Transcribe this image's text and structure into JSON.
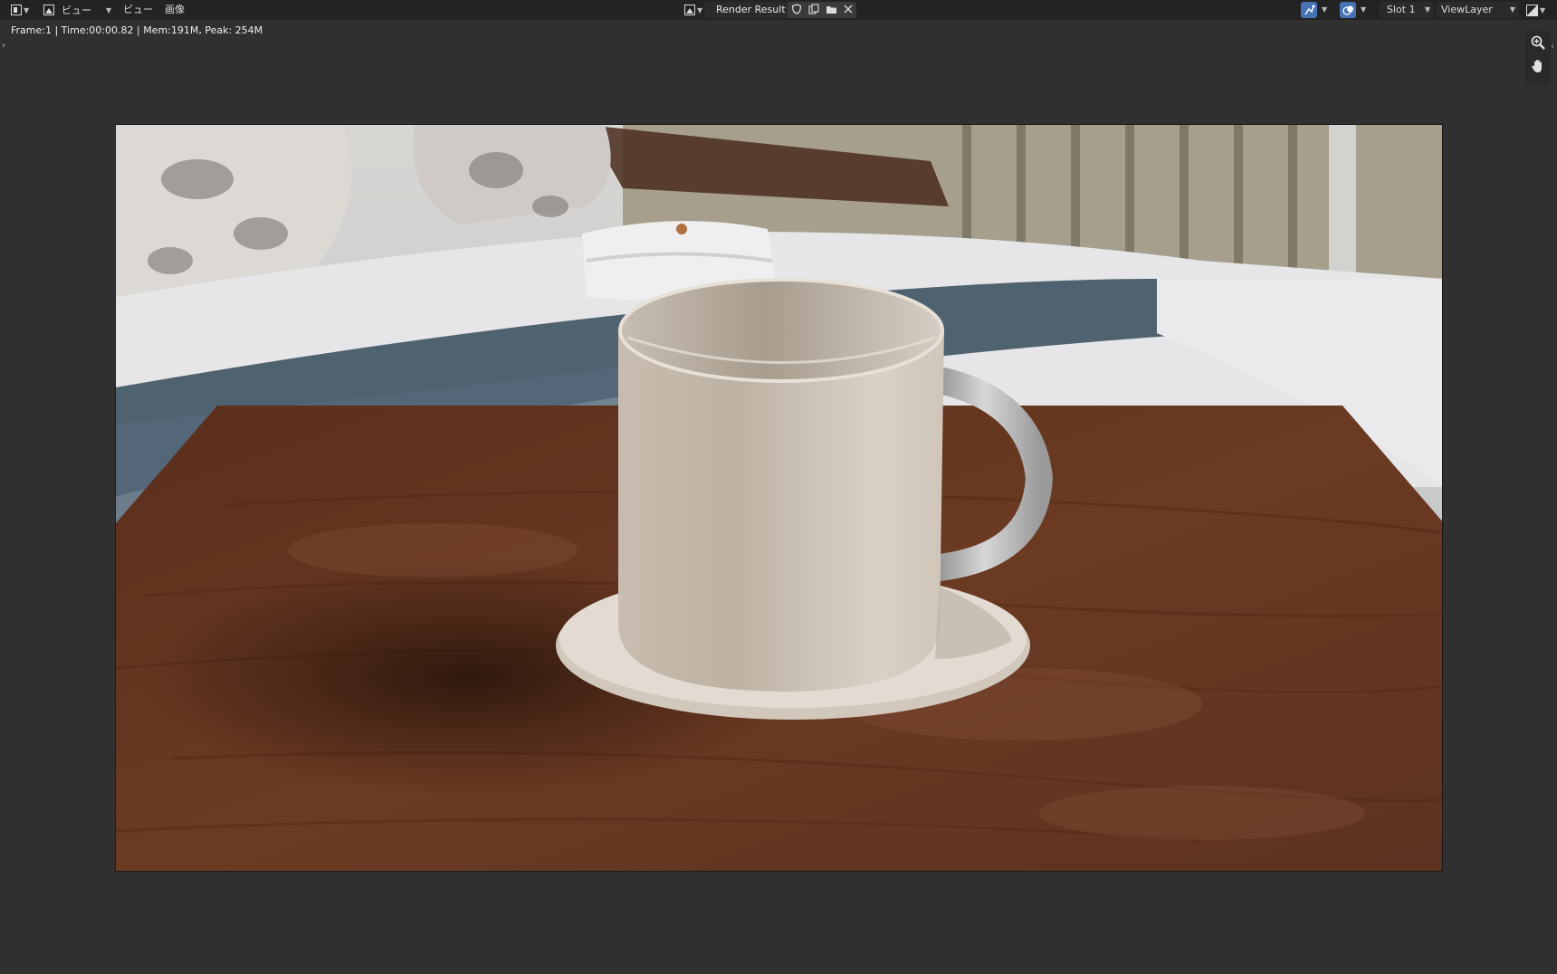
{
  "header": {
    "menus": [
      "ビュー",
      "ビュー",
      "画像"
    ],
    "image_name": "Render Result",
    "slot": "Slot 1",
    "view_layer": "ViewLayer"
  },
  "status": {
    "info": "Frame:1 | Time:00:00.82 | Mem:191M, Peak: 254M"
  },
  "icons": {
    "editor_type": "image-editor-icon",
    "image": "picture-icon",
    "fake_user": "shield-icon",
    "duplicate": "duplicate-icon",
    "open": "folder-icon",
    "unlink": "close-icon",
    "gizmo": "gizmo-icon",
    "overlay": "overlay-icon",
    "display_channels": "display-channels-icon",
    "zoom": "zoom-icon",
    "pan": "hand-icon"
  },
  "colors": {
    "accent": "#4772b3",
    "header_bg": "#232323",
    "area_bg": "#303030"
  }
}
